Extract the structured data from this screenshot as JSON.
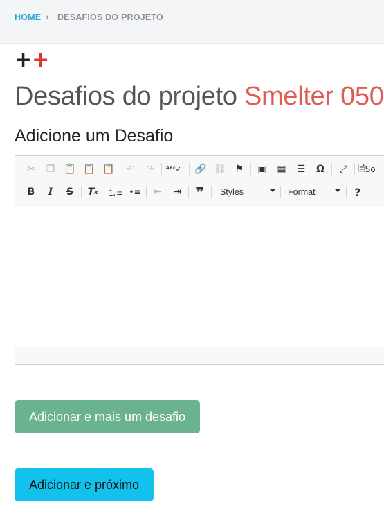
{
  "breadcrumb": {
    "home": "HOME",
    "separator": "›",
    "current": "DESAFIOS DO PROJETO"
  },
  "logo": {
    "part1": "+",
    "part2": "+"
  },
  "page_title": {
    "prefix": "Desafios do projeto",
    "project": "Smelter 050"
  },
  "section_title": "Adicione um Desafio",
  "editor": {
    "toolbar": {
      "source_label": "So",
      "styles_label": "Styles",
      "format_label": "Format"
    },
    "body_text": ""
  },
  "buttons": {
    "add_more": "Adicionar e mais um desafio",
    "add_next": "Adicionar e próximo"
  },
  "colors": {
    "breadcrumb_home": "#27a9d6",
    "title_accent": "#e05c53",
    "add_more_button": "#6bb291",
    "add_next_button": "#12c2ed",
    "logo_plus_red": "#e0342f"
  }
}
